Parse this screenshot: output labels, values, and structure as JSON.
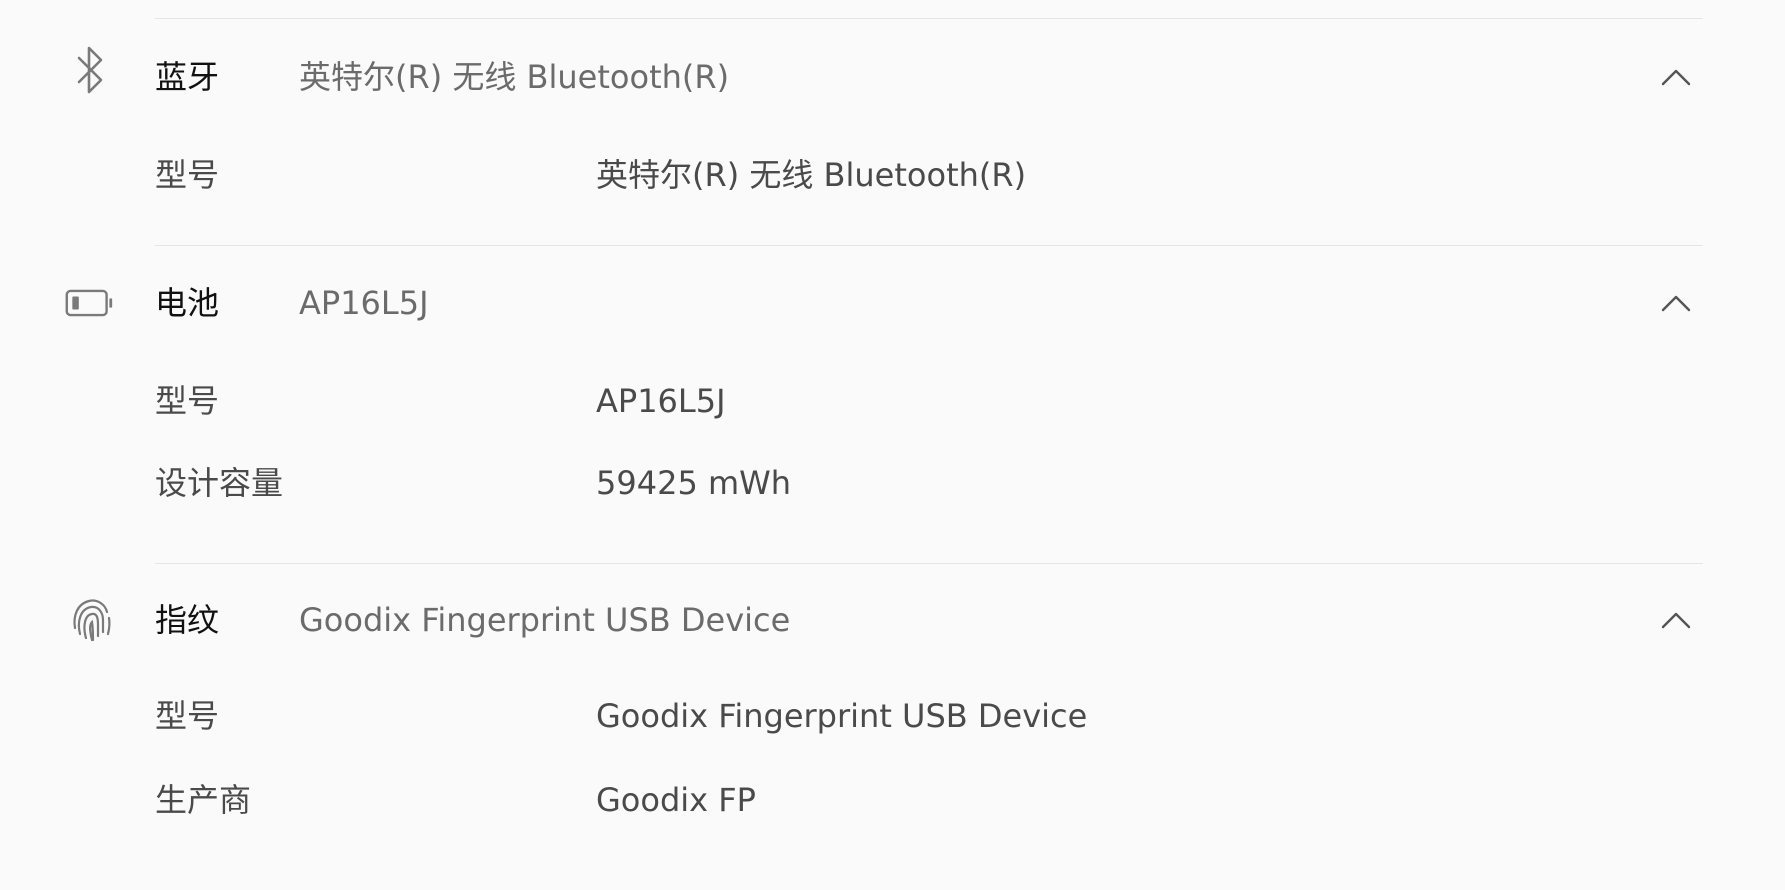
{
  "sections": [
    {
      "category": "蓝牙",
      "summary": "英特尔(R) 无线 Bluetooth(R)",
      "icon": "bluetooth-icon",
      "rows": [
        {
          "label": "型号",
          "value": "英特尔(R) 无线 Bluetooth(R)"
        }
      ]
    },
    {
      "category": "电池",
      "summary": "AP16L5J",
      "icon": "battery-icon",
      "rows": [
        {
          "label": "型号",
          "value": "AP16L5J"
        },
        {
          "label": "设计容量",
          "value": "59425 mWh"
        }
      ]
    },
    {
      "category": "指纹",
      "summary": "Goodix Fingerprint USB Device",
      "icon": "fingerprint-icon",
      "rows": [
        {
          "label": "型号",
          "value": "Goodix Fingerprint USB Device"
        },
        {
          "label": "生产商",
          "value": "Goodix FP"
        }
      ]
    }
  ],
  "colors": {
    "background": "#fafafa",
    "divider": "#e5e5e5",
    "icon": "#7a7a7a"
  }
}
